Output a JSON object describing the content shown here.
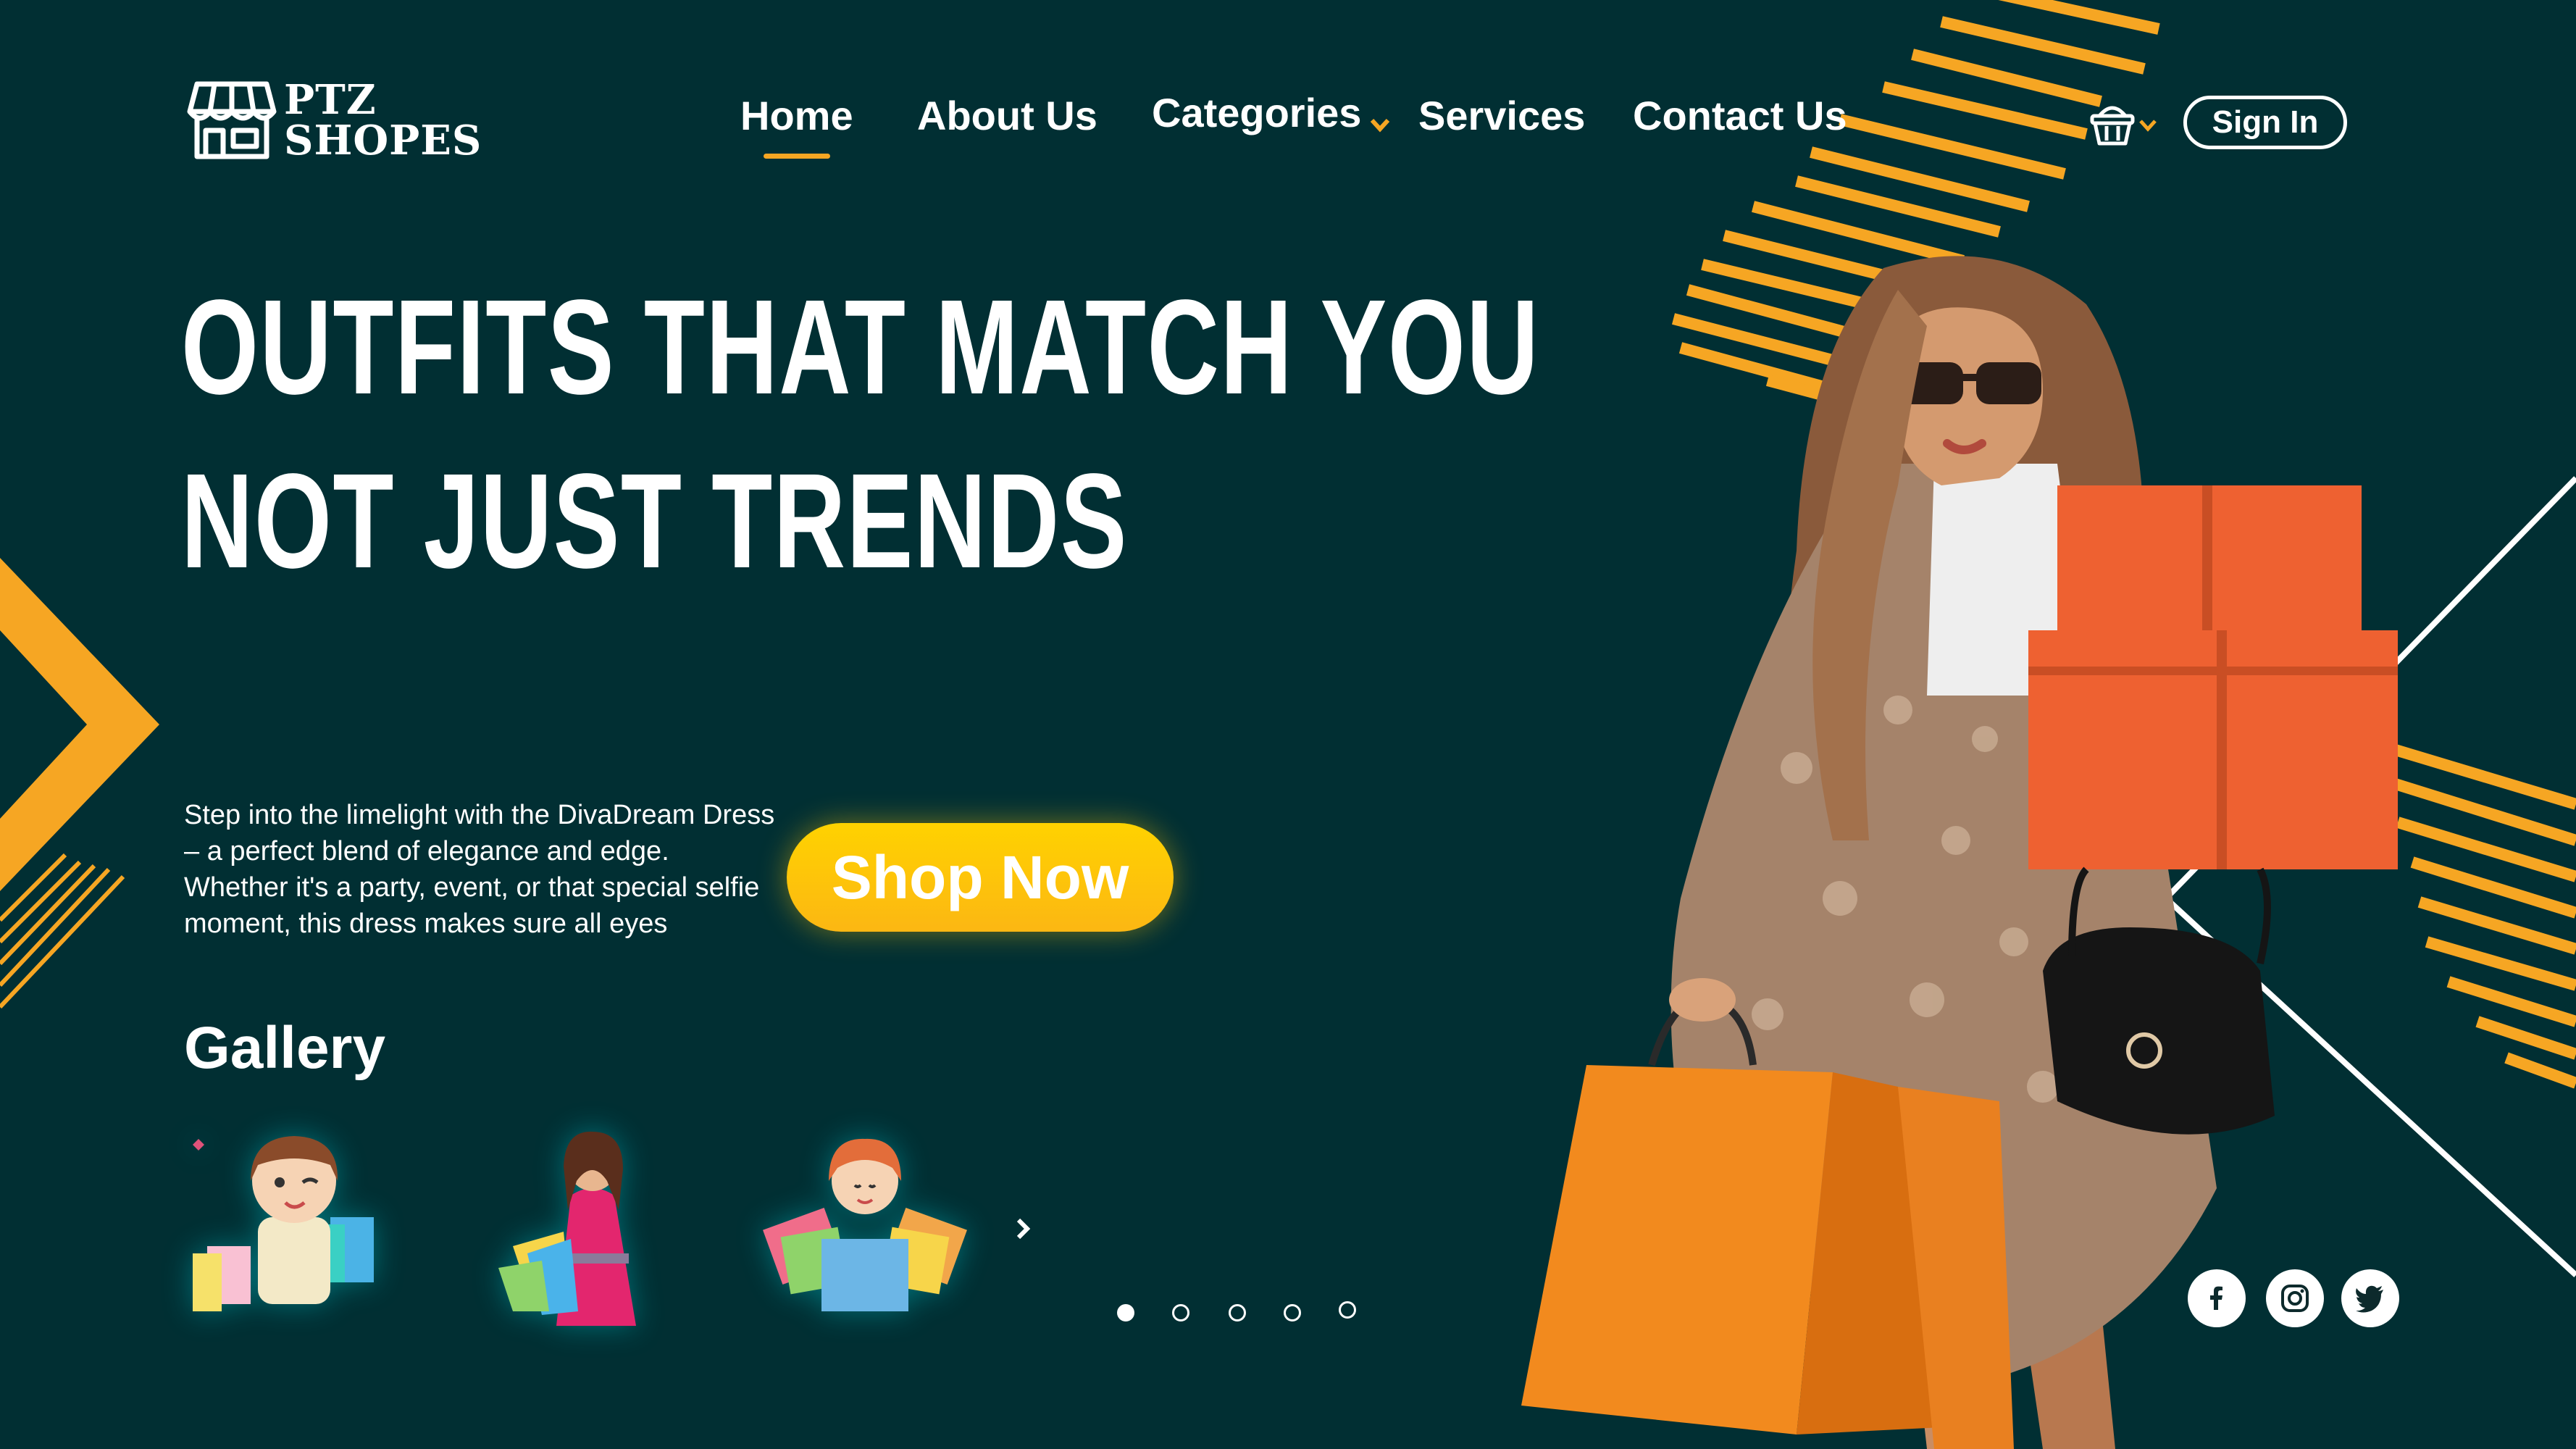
{
  "brand": {
    "name_line1": "PTZ",
    "name_line2": "SHOPES"
  },
  "nav": {
    "items": [
      {
        "label": "Home",
        "active": true
      },
      {
        "label": "About Us"
      },
      {
        "label": "Categories",
        "has_dropdown": true
      },
      {
        "label": "Services"
      },
      {
        "label": "Contact Us"
      }
    ],
    "cart_icon": "basket-icon",
    "sign_in_label": "Sign In"
  },
  "hero": {
    "headline_line1": "OUTFITS THAT MATCH YOU",
    "headline_line2": "NOT JUST TRENDS",
    "description": "Step into the limelight with the DivaDream Dress – a perfect blend of elegance and edge. Whether it's a party, event, or that special selfie moment, this dress makes sure all eyes",
    "cta_label": "Shop Now"
  },
  "gallery": {
    "title": "Gallery",
    "thumbnails": [
      "cartoon-shopper-girl",
      "woman-pink-dress-bags",
      "cartoon-woman-bags"
    ],
    "next_icon": "chevron-right-icon"
  },
  "carousel": {
    "count": 5,
    "active_index": 0
  },
  "social": [
    "facebook-icon",
    "instagram-icon",
    "twitter-icon"
  ],
  "colors": {
    "background": "#012f33",
    "accent": "#f6a623",
    "cta": "#fcb713",
    "box_orange": "#ee6131",
    "text": "#ffffff"
  }
}
